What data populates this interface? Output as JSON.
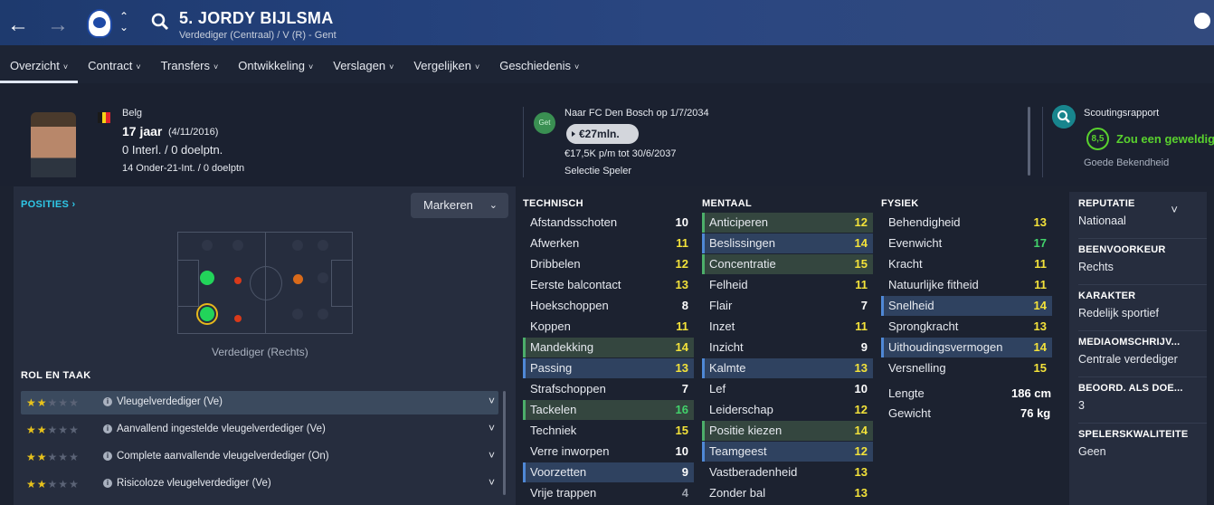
{
  "header": {
    "back_icon": "arrow-left-icon",
    "forward_icon": "arrow-right-icon",
    "player_name": "5. JORDY BIJLSMA",
    "player_subtitle": "Verdediger (Centraal) / V (R) - Gent"
  },
  "tabs": [
    {
      "label": "Overzicht",
      "active": true
    },
    {
      "label": "Contract"
    },
    {
      "label": "Transfers"
    },
    {
      "label": "Ontwikkeling"
    },
    {
      "label": "Verslagen"
    },
    {
      "label": "Vergelijken"
    },
    {
      "label": "Geschiedenis"
    }
  ],
  "profile": {
    "nationality": "Belg",
    "flag_colors": [
      "#1a1a1a",
      "#f5d315",
      "#e3262d"
    ],
    "age": "17 jaar",
    "birthdate": "(4/11/2016)",
    "caps": "0 Interl. / 0 doelptn.",
    "u21_caps": "14 Onder-21-Int. / 0 doelptn"
  },
  "transfer": {
    "badge": "Get",
    "move": "Naar FC Den Bosch op 1/7/2034",
    "value": "€27mln.",
    "wage": "€17,5K p/m tot 30/6/2037",
    "status": "Selectie Speler"
  },
  "scouting": {
    "title": "Scoutingsrapport",
    "rating": "8,5",
    "recommendation": "Zou een geweldige",
    "knowledge": "Goede Bekendheid",
    "accent": "#59d12e"
  },
  "positions": {
    "title": "POSITIES",
    "mark_button": "Markeren",
    "caption": "Verdediger (Rechts)"
  },
  "roles": {
    "title": "ROL EN TAAK",
    "items": [
      {
        "name": "Vleugelverdediger (Ve)",
        "stars": 2,
        "selected": true
      },
      {
        "name": "Aanvallend ingestelde vleugelverdediger (Ve)",
        "stars": 2
      },
      {
        "name": "Complete aanvallende vleugelverdediger (On)",
        "stars": 2
      },
      {
        "name": "Risicoloze vleugelverdediger (Ve)",
        "stars": 2
      }
    ]
  },
  "attributes": {
    "technical_title": "TECHNISCH",
    "mental_title": "MENTAAL",
    "physical_title": "FYSIEK",
    "technical": [
      {
        "name": "Afstandsschoten",
        "value": "10",
        "tone": "w"
      },
      {
        "name": "Afwerken",
        "value": "11",
        "tone": "y"
      },
      {
        "name": "Dribbelen",
        "value": "12",
        "tone": "y"
      },
      {
        "name": "Eerste balcontact",
        "value": "13",
        "tone": "y"
      },
      {
        "name": "Hoekschoppen",
        "value": "8",
        "tone": "w"
      },
      {
        "name": "Koppen",
        "value": "11",
        "tone": "y"
      },
      {
        "name": "Mandekking",
        "value": "14",
        "tone": "y",
        "hl": "g"
      },
      {
        "name": "Passing",
        "value": "13",
        "tone": "y",
        "hl": "b"
      },
      {
        "name": "Strafschoppen",
        "value": "7",
        "tone": "w"
      },
      {
        "name": "Tackelen",
        "value": "16",
        "tone": "g",
        "hl": "g"
      },
      {
        "name": "Techniek",
        "value": "15",
        "tone": "y"
      },
      {
        "name": "Verre inworpen",
        "value": "10",
        "tone": "w"
      },
      {
        "name": "Voorzetten",
        "value": "9",
        "tone": "w",
        "hl": "b"
      },
      {
        "name": "Vrije trappen",
        "value": "4",
        "tone": "gr"
      }
    ],
    "mental": [
      {
        "name": "Anticiperen",
        "value": "12",
        "tone": "y",
        "hl": "g"
      },
      {
        "name": "Beslissingen",
        "value": "14",
        "tone": "y",
        "hl": "b"
      },
      {
        "name": "Concentratie",
        "value": "15",
        "tone": "y",
        "hl": "g"
      },
      {
        "name": "Felheid",
        "value": "11",
        "tone": "y"
      },
      {
        "name": "Flair",
        "value": "7",
        "tone": "w"
      },
      {
        "name": "Inzet",
        "value": "11",
        "tone": "y"
      },
      {
        "name": "Inzicht",
        "value": "9",
        "tone": "w"
      },
      {
        "name": "Kalmte",
        "value": "13",
        "tone": "y",
        "hl": "b"
      },
      {
        "name": "Lef",
        "value": "10",
        "tone": "w"
      },
      {
        "name": "Leiderschap",
        "value": "12",
        "tone": "y"
      },
      {
        "name": "Positie kiezen",
        "value": "14",
        "tone": "y",
        "hl": "g"
      },
      {
        "name": "Teamgeest",
        "value": "12",
        "tone": "y",
        "hl": "b"
      },
      {
        "name": "Vastberadenheid",
        "value": "13",
        "tone": "y"
      },
      {
        "name": "Zonder bal",
        "value": "13",
        "tone": "y"
      }
    ],
    "physical": [
      {
        "name": "Behendigheid",
        "value": "13",
        "tone": "y"
      },
      {
        "name": "Evenwicht",
        "value": "17",
        "tone": "g"
      },
      {
        "name": "Kracht",
        "value": "11",
        "tone": "y"
      },
      {
        "name": "Natuurlijke fitheid",
        "value": "11",
        "tone": "y"
      },
      {
        "name": "Snelheid",
        "value": "14",
        "tone": "y",
        "hl": "b"
      },
      {
        "name": "Sprongkracht",
        "value": "13",
        "tone": "y"
      },
      {
        "name": "Uithoudingsvermogen",
        "value": "14",
        "tone": "y",
        "hl": "b"
      },
      {
        "name": "Versnelling",
        "value": "15",
        "tone": "y"
      }
    ],
    "length_label": "Lengte",
    "length_value": "186 cm",
    "weight_label": "Gewicht",
    "weight_value": "76 kg"
  },
  "sidebar": [
    {
      "label": "REPUTATIE",
      "value": "Nationaal"
    },
    {
      "label": "BEENVOORKEUR",
      "value": "Rechts"
    },
    {
      "label": "KARAKTER",
      "value": "Redelijk sportief"
    },
    {
      "label": "MEDIAOMSCHRIJV...",
      "value": "Centrale verdediger"
    },
    {
      "label": "BEOORD. ALS DOE...",
      "value": "3"
    },
    {
      "label": "SPELERSKWALITEITE",
      "value": "Geen"
    }
  ],
  "pitch_dots": [
    {
      "color": "#22d45a",
      "size": "large",
      "ring": false
    },
    {
      "color": "#d93a1a",
      "size": "small"
    },
    {
      "color": "#d96a1a",
      "size": "medium"
    },
    {
      "color": "#22d45a",
      "size": "large",
      "ring": true
    },
    {
      "color": "#d93a1a",
      "size": "small"
    }
  ]
}
